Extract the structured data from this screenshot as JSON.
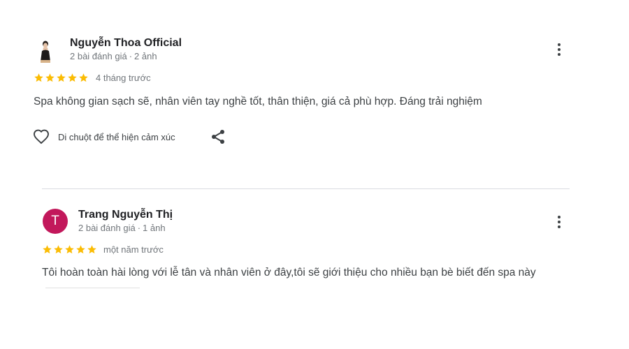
{
  "reviews": [
    {
      "author": "Nguyễn Thoa Official",
      "review_count": "2 bài đánh giá",
      "photo_count": "2 ảnh",
      "rating": 5,
      "time": "4 tháng trước",
      "text": "Spa không gian sạch sẽ, nhân viên tay nghề tốt, thân thiện, giá cả phù hợp. Đáng trải nghiệm",
      "like_hint": "Di chuột để thể hiện cảm xúc"
    },
    {
      "author": "Trang Nguyễn Thị",
      "avatar_letter": "T",
      "avatar_color": "#c2185b",
      "review_count": "2 bài đánh giá",
      "photo_count": "1 ảnh",
      "rating": 5,
      "time": "một năm trước",
      "text": "Tôi hoàn toàn hài lòng với lễ tân và nhân viên ở đây,tôi sẽ giới thiệu cho nhiều bạn bè biết đến spa này"
    }
  ],
  "meta_separator": "·",
  "colors": {
    "star": "#fbbc04",
    "divider": "#dadce0"
  },
  "icons": {
    "more": "more-vert-icon",
    "like": "heart-outline-icon",
    "share": "share-icon",
    "star": "star-icon"
  }
}
